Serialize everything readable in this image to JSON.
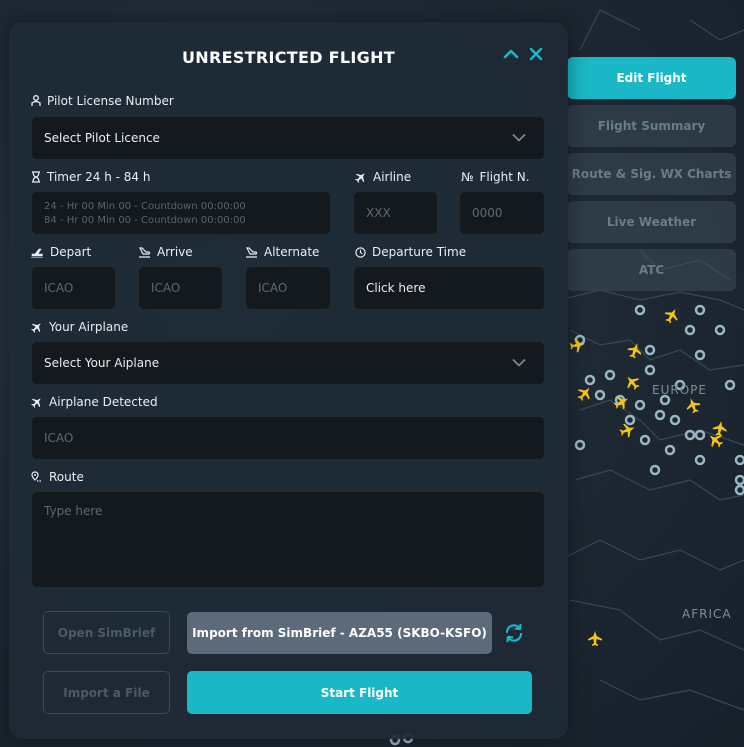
{
  "panel": {
    "title": "UNRESTRICTED FLIGHT",
    "collapse_icon": "chevron-up-icon",
    "close_icon": "close-icon"
  },
  "side_nav": [
    {
      "label": "Edit Flight",
      "active": true
    },
    {
      "label": "Flight Summary",
      "active": false
    },
    {
      "label": "Route & Sig. WX Charts",
      "active": false
    },
    {
      "label": "Live Weather",
      "active": false
    },
    {
      "label": "ATC",
      "active": false
    }
  ],
  "form": {
    "pilot_license": {
      "label": "Pilot License Number",
      "value": "Select Pilot Licence"
    },
    "timer": {
      "label": "Timer 24 h - 84 h",
      "line1": "24 - Hr 00 Min 00 - Countdown 00:00:00",
      "line2": "84 - Hr 00 Min 00 - Countdown 00:00:00"
    },
    "airline": {
      "label": "Airline",
      "placeholder": "XXX"
    },
    "flight_number": {
      "label": "Flight N.",
      "prefix": "№",
      "placeholder": "0000"
    },
    "depart": {
      "label": "Depart",
      "placeholder": "ICAO"
    },
    "arrive": {
      "label": "Arrive",
      "placeholder": "ICAO"
    },
    "alternate": {
      "label": "Alternate",
      "placeholder": "ICAO"
    },
    "departure_time": {
      "label": "Departure Time",
      "value": "Click here"
    },
    "your_airplane": {
      "label": "Your Airplane",
      "value": "Select Your Aiplane"
    },
    "airplane_detected": {
      "label": "Airplane Detected",
      "placeholder": "ICAO"
    },
    "route": {
      "label": "Route",
      "placeholder": "Type here"
    }
  },
  "actions": {
    "open_simbrief": "Open SimBrief",
    "import_simbrief": "Import from SimBrief - AZA55 (SKBO-KSFO)",
    "import_file": "Import a File",
    "start_flight": "Start Flight",
    "refresh_icon": "refresh-icon"
  },
  "map": {
    "labels": [
      "EUROPE",
      "AFRICA"
    ]
  },
  "colors": {
    "accent": "#1ab8c6",
    "panel_bg": "#1e2a36",
    "field_bg": "#14191e",
    "airplane_marker": "#f5c518",
    "airport_marker": "#a9c6d4"
  }
}
